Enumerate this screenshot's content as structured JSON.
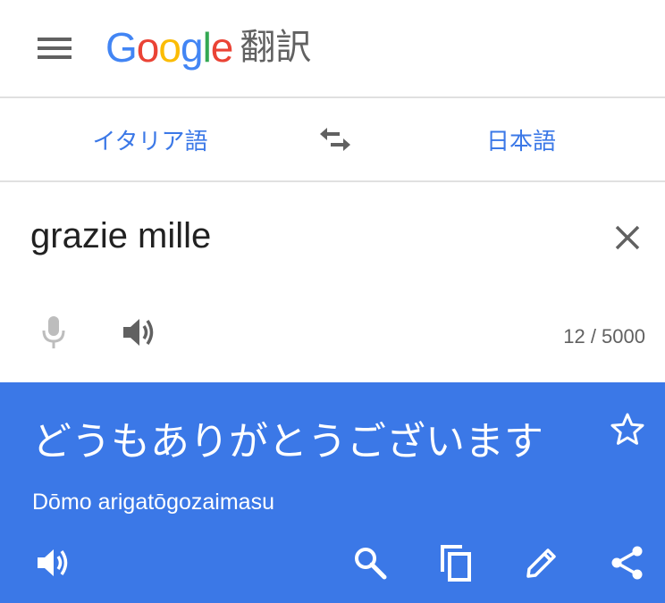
{
  "header": {
    "menu_icon": "hamburger-menu-icon",
    "logo_letters": [
      {
        "ch": "G",
        "color": "#4285f4"
      },
      {
        "ch": "o",
        "color": "#ea4335"
      },
      {
        "ch": "o",
        "color": "#fbbc05"
      },
      {
        "ch": "g",
        "color": "#4285f4"
      },
      {
        "ch": "l",
        "color": "#34a853"
      },
      {
        "ch": "e",
        "color": "#ea4335"
      }
    ],
    "product_name": "翻訳"
  },
  "languages": {
    "source": "イタリア語",
    "target": "日本語",
    "swap_icon": "swap-arrows-icon"
  },
  "input": {
    "text": "grazie mille",
    "char_count": "12 / 5000"
  },
  "result": {
    "text": "どうもありがとうございます",
    "romanization": "Dōmo arigatōgozaimasu"
  },
  "colors": {
    "accent": "#3b78e7",
    "text_primary": "#212121",
    "icon_gray": "#616161",
    "mic_disabled": "#bdbdbd"
  }
}
